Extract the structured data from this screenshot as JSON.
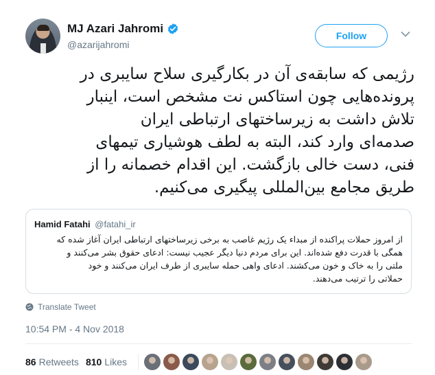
{
  "author": {
    "display_name": "MJ Azari Jahromi",
    "handle": "@azarijahromi",
    "verified": true
  },
  "follow_label": "Follow",
  "tweet_text": "رژیمی که سابقه‌ی آن در بکارگیری سلاح سایبری در\nپرونده‌هایی چون استاکس نت مشخص است، اینبار\nتلاش داشت به زیرساختهای ارتباطی ایران\nصدمه‌ای وارد کند، البته به لطف هوشیاری تیمهای\nفنی، دست خالی بازگشت. این اقدام خصمانه را از\nطریق مجامع بین‌المللی پیگیری می‌کنیم.",
  "quoted_tweet": {
    "name": "Hamid Fatahi",
    "handle": "@fatahi_ir",
    "text": "از امروز حملات پراکنده از مبداء یک رژیم غاصب به برخی زیرساختهای ارتباطی ایران آغاز شده که\nهمگی با قدرت دفع شده‌اند. این برای مردم دنیا دیگر عجیب نیست: ادعای حقوق بشر می‌کنند و\nملتی را به خاک و خون می‌کشند. ادعای واهی حمله سایبری از طرف ایران می‌کنند و خود\nحملاتی را ترتیب می‌دهند."
  },
  "translate_label": "Translate Tweet",
  "timestamp": "10:54 PM - 4 Nov 2018",
  "stats": {
    "retweets_count": "86",
    "retweets_label": "Retweets",
    "likes_count": "810",
    "likes_label": "Likes"
  },
  "likers": [
    "#6b6f78",
    "#8a5a4a",
    "#3b4a5c",
    "#b7a48e",
    "#c8c0b5",
    "#5a6b3c",
    "#7c7f86",
    "#46505c",
    "#9a8672",
    "#3e3a36",
    "#2c2f34",
    "#a89b8c"
  ],
  "colors": {
    "accent": "#1da1f2",
    "secondary_text": "#657786",
    "border": "#e6ecf0"
  }
}
